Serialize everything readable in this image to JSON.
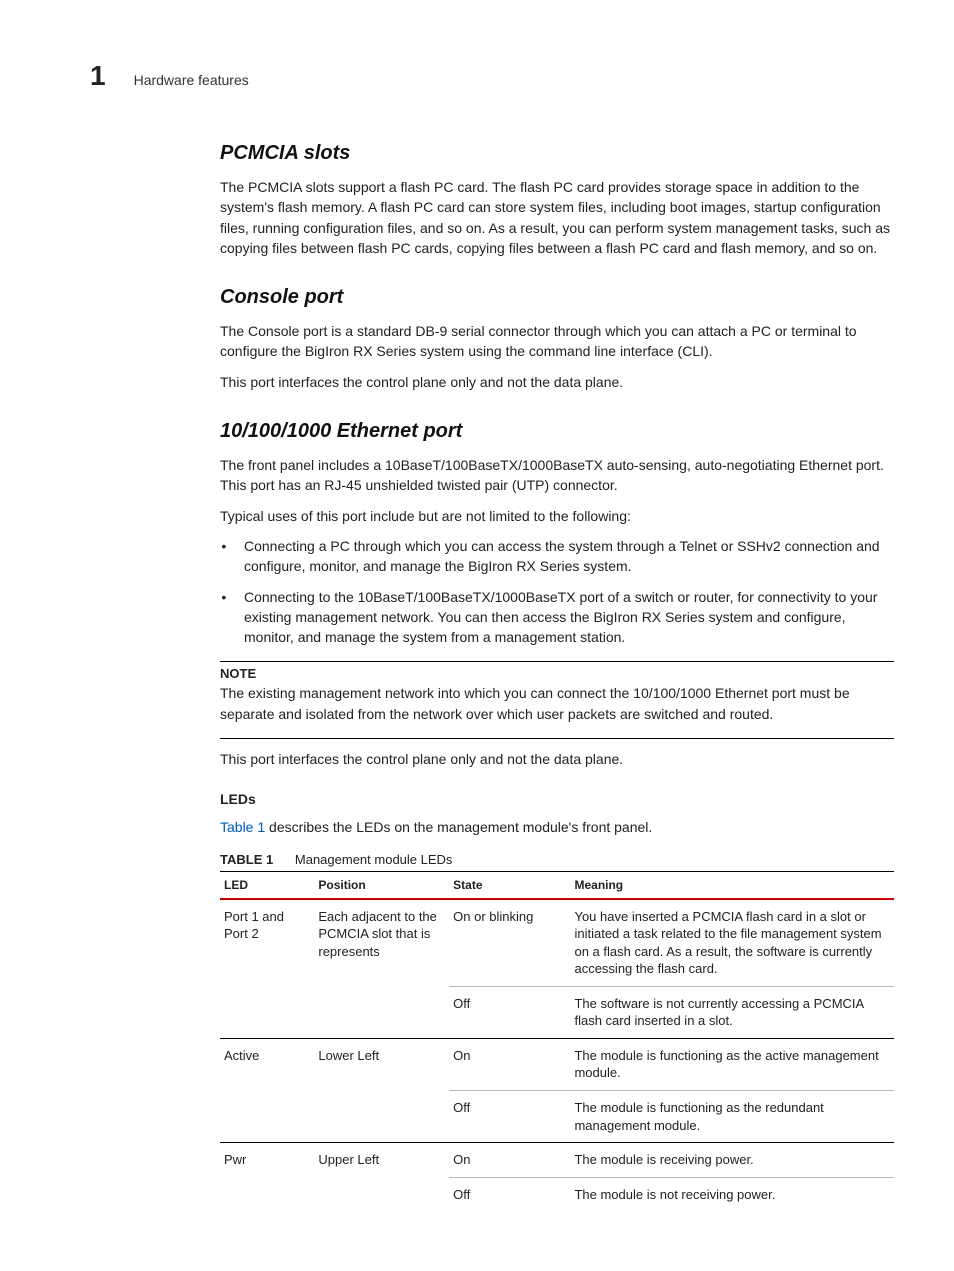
{
  "chapter_number": "1",
  "breadcrumb": "Hardware features",
  "h_pcmcia": "PCMCIA slots",
  "p_pcmcia": "The PCMCIA slots support a flash PC card. The flash PC card provides storage space in addition to the system's flash memory. A flash PC card can store system files, including boot images, startup configuration files, running configuration files, and so on. As a result, you can perform system management tasks, such as copying files between flash PC cards, copying files between a flash PC card and flash memory, and so on.",
  "h_console": "Console port",
  "p_console1": "The Console port is a standard DB-9 serial connector through which you can attach a PC or terminal to configure the BigIron RX Series system using the command line interface (CLI).",
  "p_console2": "This port interfaces the control plane only and not the data plane.",
  "h_eth": "10/100/1000 Ethernet port",
  "p_eth1": "The front panel includes a 10BaseT/100BaseTX/1000BaseTX auto-sensing, auto-negotiating Ethernet port. This port has an RJ-45 unshielded twisted pair (UTP) connector.",
  "p_eth2": "Typical uses of this port include but are not limited to the following:",
  "li_eth1": "Connecting a PC through which you can access the system through a Telnet or SSHv2 connection and configure, monitor, and manage the BigIron RX Series system.",
  "li_eth2": "Connecting to the 10BaseT/100BaseTX/1000BaseTX port of a switch or router, for connectivity to your existing management network. You can then access the BigIron RX Series system and configure, monitor, and manage the system from a management station.",
  "note_head": "NOTE",
  "note_body": "The existing management network into which you can connect the 10/100/1000 Ethernet port must be separate and isolated from the network over which user packets are switched and routed.",
  "p_eth3": "This port interfaces the control plane only and not the data plane.",
  "leds_head": "LEDs",
  "leds_xref": "Table 1",
  "leds_rest": " describes the LEDs on the management module's front panel.",
  "tablecap_label": "TABLE 1",
  "tablecap_title": "Management module LEDs",
  "th_led": "LED",
  "th_pos": "Position",
  "th_state": "State",
  "th_mean": "Meaning",
  "rows": {
    "port": {
      "led": "Port 1 and Port 2",
      "pos": "Each adjacent to the PCMCIA slot that is represents",
      "state1": "On or blinking",
      "mean1": "You have inserted a PCMCIA flash card in a slot or initiated a task related to the file management system on a flash card. As a result, the software is currently accessing the flash card.",
      "state2": "Off",
      "mean2": "The software is not currently accessing a PCMCIA flash card inserted in a slot."
    },
    "active": {
      "led": "Active",
      "pos": "Lower Left",
      "state1": "On",
      "mean1": "The module is functioning as the active management module.",
      "state2": "Off",
      "mean2": "The module is functioning as the redundant management module."
    },
    "pwr": {
      "led": "Pwr",
      "pos": "Upper Left",
      "state1": "On",
      "mean1": "The module is receiving power.",
      "state2": "Off",
      "mean2": "The module is not receiving power."
    }
  }
}
